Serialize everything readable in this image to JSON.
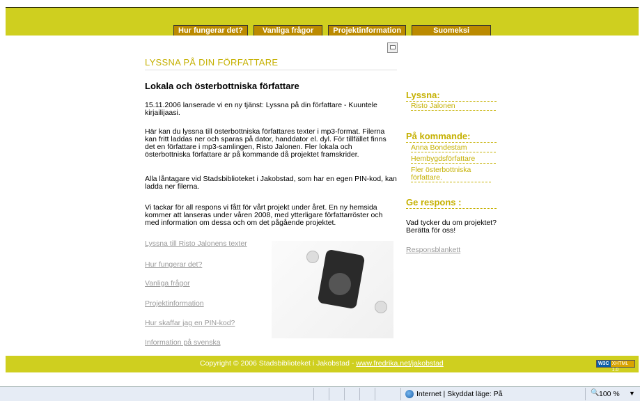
{
  "nav": {
    "items": [
      "Hur fungerar det?",
      "Vanliga frågor",
      "Projektinformation",
      "Suomeksi"
    ]
  },
  "main": {
    "heading": "LYSSNA PÅ DIN FÖRFATTARE",
    "article_title": "Lokala och österbottniska författare",
    "paragraphs": [
      "15.11.2006 lanserade vi en ny tjänst: Lyssna på din författare - Kuuntele kirjailijaasi.",
      "Här kan du lyssna till österbottniska författares texter i mp3-format. Filerna kan fritt laddas ner och sparas på dator, handdator el. dyl. För tillfället finns det en författare i mp3-samlingen, Risto Jalonen. Fler lokala och österbottniska författare är på kommande då projektet framskrider.",
      "Alla låntagare vid Stadsbiblioteket i Jakobstad, som har en egen PIN-kod, kan ladda ner filerna.",
      "Vi tackar för all respons vi fått för vårt projekt under året. En ny hemsida kommer att lanseras under våren 2008, med ytterligare författarröster och med information om dessa och om det pågående projektet."
    ],
    "links": [
      "Lyssna till Risto Jalonens texter",
      "Hur fungerar det?",
      "Vanliga frågor",
      "Projektinformation",
      "Hur skaffar jag en PIN-kod?",
      "Information på svenska"
    ]
  },
  "sidebar": {
    "listen_heading": "Lyssna:",
    "listen_items": [
      "Risto Jalonen"
    ],
    "upcoming_heading": "På kommande:",
    "upcoming_items": [
      "Anna Bondestam",
      "Hembygdsförfattare",
      "Fler österbottniska författare."
    ],
    "feedback_heading": "Ge respons :",
    "feedback_text": "Vad tycker du om projektet? Berätta för oss!",
    "feedback_link": "Responsblankett"
  },
  "footer": {
    "copyright": "Copyright © 2006 Stadsbiblioteket i Jakobstad - ",
    "link": "www.fredrika.net/jakobstad",
    "badge_left": "W3C",
    "badge_right": "XHTML 1.0"
  },
  "statusbar": {
    "zone": "Internet | Skyddat läge: På",
    "zoom": "100 %"
  },
  "colors": {
    "header": "#cfcf1f",
    "nav_button": "#bb8a00",
    "accent_text": "#c5b000"
  }
}
